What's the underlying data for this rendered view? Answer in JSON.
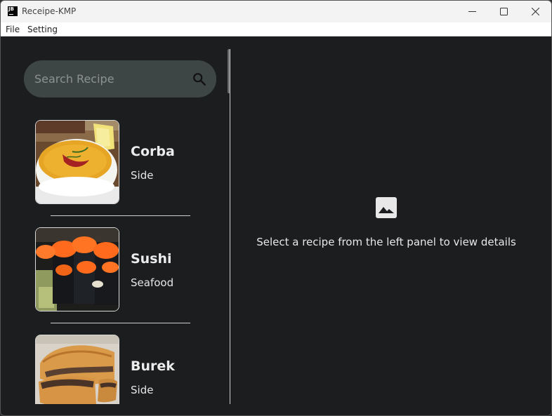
{
  "window": {
    "title": "Receipe-KMP",
    "icon_text": "JB",
    "controls": [
      "minimize-icon",
      "maximize-icon",
      "close-icon"
    ]
  },
  "menu": {
    "items": [
      {
        "label": "File"
      },
      {
        "label": "Setting"
      }
    ]
  },
  "search": {
    "placeholder": "Search Recipe",
    "value": "",
    "icon": "search-icon"
  },
  "recipes": [
    {
      "name": "Corba",
      "category": "Side",
      "image": "soup-bowl-image"
    },
    {
      "name": "Sushi",
      "category": "Seafood",
      "image": "sushi-rolls-image"
    },
    {
      "name": "Burek",
      "category": "Side",
      "image": "pastry-image"
    }
  ],
  "detail": {
    "empty_icon": "image-placeholder-icon",
    "empty_message": "Select a recipe from the left panel to view details"
  },
  "colors": {
    "background": "#1b1d1f",
    "search_field": "#3e4545",
    "text": "#ececec"
  }
}
